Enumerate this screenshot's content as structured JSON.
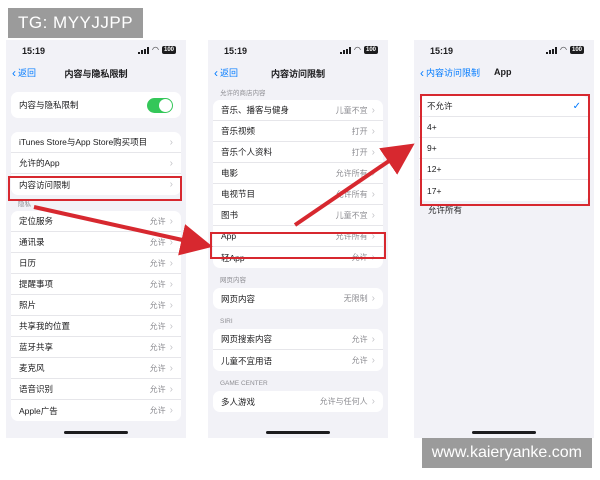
{
  "watermark_top": "TG: MYYJJPP",
  "watermark_bottom": "www.kaieryanke.com",
  "status": {
    "time": "15:19",
    "battery": "100"
  },
  "phone1": {
    "back": "返回",
    "title": "内容与隐私限制",
    "toggle_label": "内容与隐私限制",
    "toggle_on": true,
    "group2": [
      "iTunes Store与App Store购买项目",
      "允许的App",
      "内容访问限制"
    ],
    "privacy_header": "隐私",
    "privacy_items": [
      {
        "label": "定位服务",
        "value": "允许"
      },
      {
        "label": "通讯录",
        "value": "允许"
      },
      {
        "label": "日历",
        "value": "允许"
      },
      {
        "label": "提醒事项",
        "value": "允许"
      },
      {
        "label": "照片",
        "value": "允许"
      },
      {
        "label": "共享我的位置",
        "value": "允许"
      },
      {
        "label": "蓝牙共享",
        "value": "允许"
      },
      {
        "label": "麦克风",
        "value": "允许"
      },
      {
        "label": "语音识别",
        "value": "允许"
      },
      {
        "label": "Apple广告",
        "value": "允许"
      }
    ]
  },
  "phone2": {
    "back": "返回",
    "title": "内容访问限制",
    "section_store": "允许的商店内容",
    "store_items": [
      {
        "label": "音乐、播客与健身",
        "value": "儿童不宜"
      },
      {
        "label": "音乐视频",
        "value": "打开"
      },
      {
        "label": "音乐个人资料",
        "value": "打开"
      },
      {
        "label": "电影",
        "value": "允许所有"
      },
      {
        "label": "电视节目",
        "value": "允许所有"
      },
      {
        "label": "图书",
        "value": "儿童不宜"
      },
      {
        "label": "App",
        "value": "允许所有"
      },
      {
        "label": "轻App",
        "value": "允许"
      }
    ],
    "section_web": "网页内容",
    "web_items": [
      {
        "label": "网页内容",
        "value": "无限制"
      }
    ],
    "section_siri": "SIRI",
    "siri_items": [
      {
        "label": "网页搜索内容",
        "value": "允许"
      },
      {
        "label": "儿童不宜用语",
        "value": "允许"
      }
    ],
    "section_game": "GAME CENTER",
    "game_items": [
      {
        "label": "多人游戏",
        "value": "允许与任何人"
      }
    ]
  },
  "phone3": {
    "back": "内容访问限制",
    "title": "App",
    "options": [
      "不允许",
      "4+",
      "9+",
      "12+",
      "17+"
    ],
    "selected_index": 0,
    "allow_all": "允许所有"
  },
  "colors": {
    "highlight": "#d7282f",
    "accent": "#007aff",
    "toggle": "#34c759"
  }
}
